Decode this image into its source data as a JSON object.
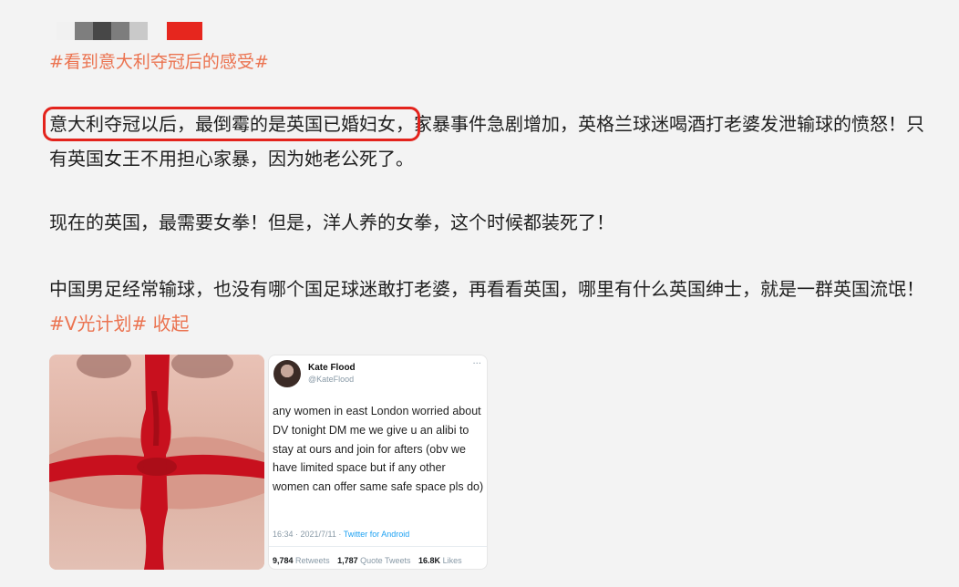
{
  "post": {
    "topic_tag": "#看到意大利夺冠后的感受#",
    "paragraph1": {
      "highlighted": "意大利夺冠以后，最倒霉的是英国已婚妇女，",
      "rest": "家暴事件急剧增加，英格兰球迷喝酒打老婆发泄输球的愤怒！只有英国女王不用担心家暴，因为她老公死了。"
    },
    "paragraph2": "现在的英国，最需要女拳！但是，洋人养的女拳，这个时候都装死了！",
    "paragraph3": {
      "text": "中国男足经常输球，也没有哪个国足球迷敢打老婆，再看看英国，哪里有什么英国绅士，就是一群英国流氓！",
      "hashtag": "#V光计划#",
      "collapse_label": "收起"
    }
  },
  "tweet": {
    "name": "Kate Flood",
    "handle": "@KateFlood",
    "more": "···",
    "text": "any women in east London worried about DV tonight DM me we give u an alibi to stay at ours and join for afters (obv we have limited space but if any other women can offer same safe space pls do)",
    "time": "16:34 · 2021/7/11 · ",
    "source": "Twitter for Android",
    "retweets_count": "9,784",
    "retweets_label": "Retweets",
    "quotes_count": "1,787",
    "quotes_label": "Quote Tweets",
    "likes_count": "16.8K",
    "likes_label": "Likes"
  },
  "colors": {
    "accent": "#eb7350",
    "highlight_box": "#e3231c",
    "blood_red": "#c8101e"
  }
}
